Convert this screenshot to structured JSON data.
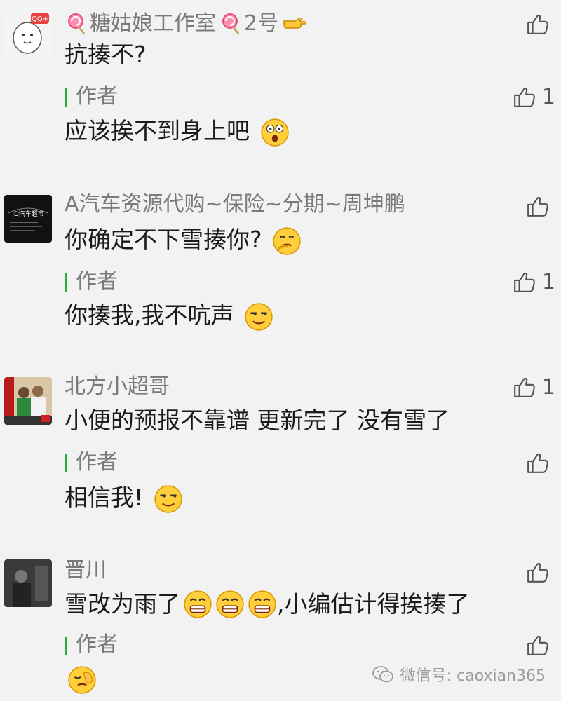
{
  "comments": [
    {
      "name": "糖姑娘工作室",
      "name_suffix": "2号",
      "text": "抗揍不?",
      "likes": "",
      "reply": {
        "tag": "作者",
        "text": "应该挨不到身上吧",
        "likes": "1"
      }
    },
    {
      "name": "A汽车资源代购~保险~分期~周坤鹏",
      "text": "你确定不下雪揍你?",
      "likes": "",
      "avatar_caption": "JD汽车超市",
      "reply": {
        "tag": "作者",
        "text": "你揍我,我不吭声",
        "likes": "1"
      }
    },
    {
      "name": "北方小超哥",
      "text": "小便的预报不靠谱  更新完了 没有雪了",
      "likes": "1",
      "reply": {
        "tag": "作者",
        "text": "相信我!",
        "likes": ""
      }
    },
    {
      "name": "晋川",
      "text": "雪改为雨了",
      "text_suffix": ",小编估计得挨揍了",
      "likes": "",
      "reply": {
        "tag": "作者",
        "text": "",
        "likes": ""
      }
    }
  ],
  "watermark": "微信号: caoxian365",
  "colors": {
    "author_bar": "#27ae3a",
    "name": "#7a7a7a",
    "background": "#f2f2f2"
  }
}
